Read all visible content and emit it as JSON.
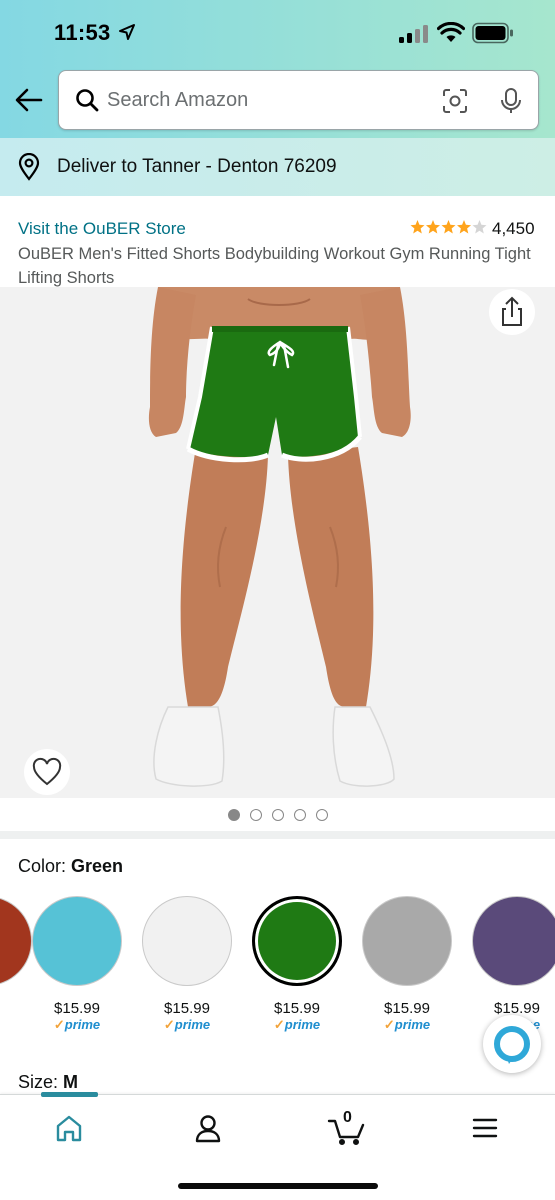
{
  "status_bar": {
    "time": "11:53"
  },
  "search": {
    "placeholder": "Search Amazon"
  },
  "delivery": {
    "text": "Deliver to Tanner - Denton 76209"
  },
  "product": {
    "store_link": "Visit the OuBER Store",
    "rating_stars": 4,
    "rating_count": "4,450",
    "title": "OuBER Men's Fitted Shorts Bodybuilding Workout Gym Running Tight Lifting Shorts"
  },
  "gallery": {
    "total_images": 5,
    "current_index": 1
  },
  "color": {
    "label": "Color:",
    "selected": "Green",
    "options": [
      {
        "name": "Red",
        "price": "",
        "prime": "",
        "color": "#a2361e"
      },
      {
        "name": "Light Blue",
        "price": "$15.99",
        "prime": "prime",
        "color": "#56c2d6"
      },
      {
        "name": "White",
        "price": "$15.99",
        "prime": "prime",
        "color": "#f1f1f1"
      },
      {
        "name": "Green",
        "price": "$15.99",
        "prime": "prime",
        "color": "#1f7a14"
      },
      {
        "name": "Gray",
        "price": "$15.99",
        "prime": "prime",
        "color": "#a9a9a9"
      },
      {
        "name": "Purple",
        "price": "$15.99",
        "prime": "prime",
        "color": "#5a4a7a"
      }
    ]
  },
  "size": {
    "label": "Size:",
    "selected": "M"
  },
  "bottom_nav": {
    "cart_count": "0",
    "active_tab": "home"
  },
  "colors": {
    "link": "#007185",
    "star": "#ffa41c",
    "prime": "#1f8ecf",
    "accent": "#2a8c9e"
  }
}
